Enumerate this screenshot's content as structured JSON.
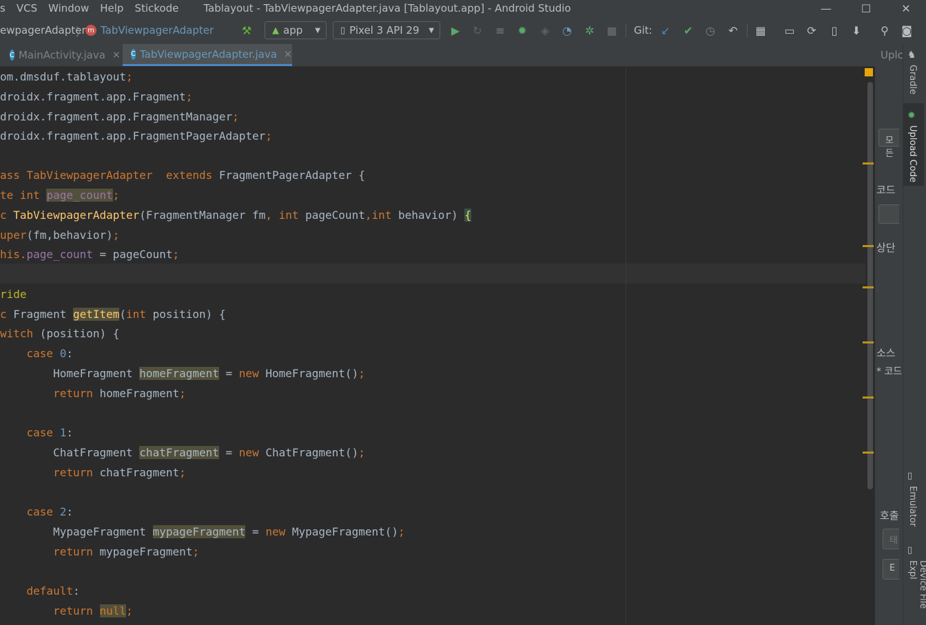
{
  "menubar": {
    "items": [
      "s",
      "VCS",
      "Window",
      "Help",
      "Stickode"
    ],
    "window_title": "Tablayout - TabViewpagerAdapter.java [Tablayout.app] - Android Studio",
    "controls": [
      "—",
      "☐",
      "✕"
    ]
  },
  "toolbar": {
    "breadcrumb_prev": "ewpagerAdapter",
    "breadcrumb_sep": "〉",
    "breadcrumb_icon_letter": "m",
    "breadcrumb_current": "TabViewpagerAdapter",
    "run_config": "app",
    "device": "Pixel 3 API 29",
    "git_label": "Git:"
  },
  "tabs": [
    {
      "label": "MainActivity.java",
      "icon_letter": "C",
      "close": "×",
      "active": false
    },
    {
      "label": "TabViewpagerAdapter.java",
      "icon_letter": "C",
      "close": "×",
      "active": true
    }
  ],
  "right_panel": {
    "top_label": "Uplc",
    "gradle": "Gradle",
    "upload_code": "Upload Code",
    "emulator": "Emulator",
    "device_file": "Device File Expl",
    "ko_btn1": "모든",
    "ko_code": "코드",
    "ko_top": "상단",
    "ko_source": "소스",
    "ko_code2": "* 코드",
    "ko_call": "호출",
    "ko_input": "태",
    "ko_btn2": "E"
  },
  "code": {
    "l1_a": "om.dmsduf.tablayout",
    "l1_b": ";",
    "l2_a": "droidx.fragment.app.Fragment",
    "l2_b": ";",
    "l3_a": "droidx.fragment.app.FragmentManager",
    "l3_b": ";",
    "l4_a": "droidx.fragment.app.FragmentPagerAdapter",
    "l4_b": ";",
    "l6_a": "ass TabViewpagerAdapter  ",
    "l6_b": "extends",
    "l6_c": " FragmentPagerAdapter {",
    "l7_a": "te int ",
    "l7_b": "page_count",
    "l7_c": ";",
    "l8_a": "c ",
    "l8_b": "TabViewpagerAdapter",
    "l8_c": "(FragmentManager fm",
    "l8_d": ", int",
    "l8_e": " pageCount",
    "l8_f": ",int",
    "l8_g": " behavior) ",
    "l8_h": "{",
    "l9_a": "uper",
    "l9_b": "(fm,behavior)",
    "l9_c": ";",
    "l10_a": "his.",
    "l10_b": "page_count",
    "l10_c": " = pageCount",
    "l10_d": ";",
    "l12_a": "ride",
    "l13_a": "c ",
    "l13_b": "Fragment ",
    "l13_c": "getItem",
    "l13_d": "(",
    "l13_e": "int",
    "l13_f": " position) {",
    "l14_a": "witch",
    "l14_b": " (position) {",
    "l15_a": "    case ",
    "l15_b": "0",
    "l15_c": ":",
    "l16_a": "        HomeFragment ",
    "l16_b": "homeFragment",
    "l16_c": " = ",
    "l16_d": "new",
    "l16_e": " HomeFragment()",
    "l16_f": ";",
    "l17_a": "        return",
    "l17_b": " homeFragment",
    "l17_c": ";",
    "l19_a": "    case ",
    "l19_b": "1",
    "l19_c": ":",
    "l20_a": "        ChatFragment ",
    "l20_b": "chatFragment",
    "l20_c": " = ",
    "l20_d": "new",
    "l20_e": " ChatFragment()",
    "l20_f": ";",
    "l21_a": "        return",
    "l21_b": " chatFragment",
    "l21_c": ";",
    "l23_a": "    case ",
    "l23_b": "2",
    "l23_c": ":",
    "l24_a": "        MypageFragment ",
    "l24_b": "mypageFragment",
    "l24_c": " = ",
    "l24_d": "new",
    "l24_e": " MypageFragment()",
    "l24_f": ";",
    "l25_a": "        return",
    "l25_b": " mypageFragment",
    "l25_c": ";",
    "l27_a": "    default",
    "l27_b": ":",
    "l28_a": "        return ",
    "l28_b": "null",
    "l28_c": ";"
  },
  "colors": {
    "background": "#2b2b2b",
    "keyword": "#cc7832",
    "number": "#6897bb",
    "field": "#9876aa",
    "function": "#ffc66d",
    "annotation": "#bbb529"
  }
}
